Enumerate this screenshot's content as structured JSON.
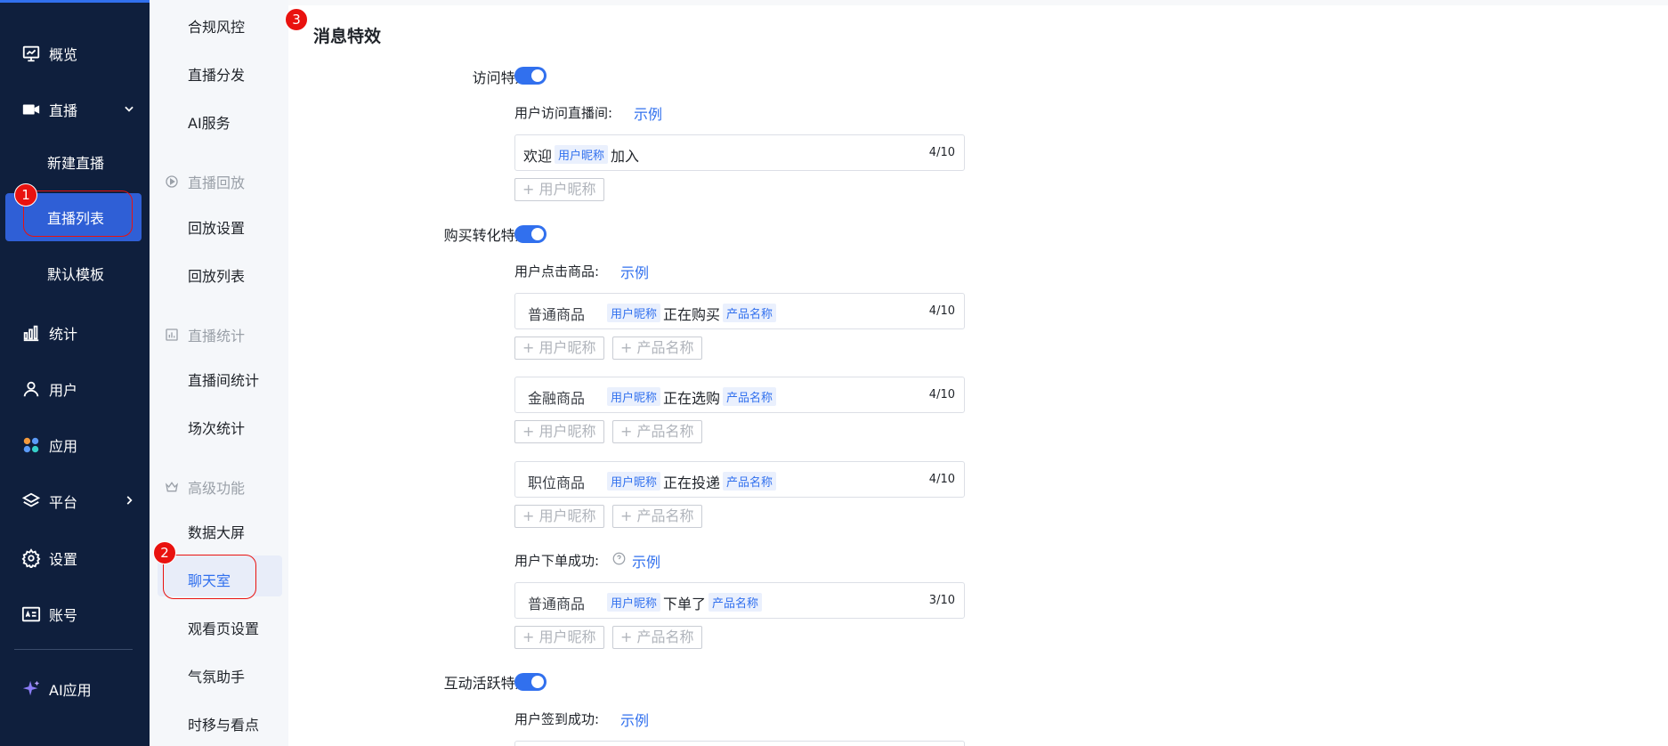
{
  "sidebar": {
    "items": [
      {
        "label": "概览",
        "icon": "monitor-icon"
      },
      {
        "label": "直播",
        "icon": "video-camera-icon"
      },
      {
        "label": "新建直播"
      },
      {
        "label": "直播列表"
      },
      {
        "label": "默认模板"
      },
      {
        "label": "统计",
        "icon": "bar-chart-icon"
      },
      {
        "label": "用户",
        "icon": "user-icon"
      },
      {
        "label": "应用",
        "icon": "apps-icon"
      },
      {
        "label": "平台",
        "icon": "layers-icon"
      },
      {
        "label": "设置",
        "icon": "gear-icon"
      },
      {
        "label": "账号",
        "icon": "id-card-icon"
      },
      {
        "label": "AI应用",
        "icon": "sparkle-icon"
      }
    ]
  },
  "submenu": {
    "items": [
      "合规风控",
      "直播分发",
      "AI服务",
      "回放设置",
      "回放列表",
      "直播间统计",
      "场次统计",
      "数据大屏",
      "聊天室",
      "观看页设置",
      "气氛助手",
      "时移与看点"
    ],
    "groups": [
      "直播回放",
      "直播统计",
      "高级功能"
    ]
  },
  "badges": [
    "1",
    "2",
    "3"
  ],
  "main": {
    "title": "消息特效",
    "visit": {
      "label": "访问特效:",
      "sub_label": "用户访问直播间:",
      "example": "示例",
      "tpl_pre": "欢迎",
      "tag_user": "用户昵称",
      "tpl_post": "加入",
      "count": "4/10",
      "add_user": "+ 用户昵称"
    },
    "buy": {
      "label": "购买转化特效:",
      "sub_label": "用户点击商品:",
      "example": "示例",
      "rows": [
        {
          "cat": "普通商品",
          "tag_user": "用户昵称",
          "verb": "正在购买",
          "tag_product": "产品名称",
          "count": "4/10"
        },
        {
          "cat": "金融商品",
          "tag_user": "用户昵称",
          "verb": "正在选购",
          "tag_product": "产品名称",
          "count": "4/10"
        },
        {
          "cat": "职位商品",
          "tag_user": "用户昵称",
          "verb": "正在投递",
          "tag_product": "产品名称",
          "count": "4/10"
        }
      ],
      "order_label": "用户下单成功:",
      "order_example": "示例",
      "order_row": {
        "cat": "普通商品",
        "tag_user": "用户昵称",
        "verb": "下单了",
        "tag_product": "产品名称",
        "count": "3/10"
      },
      "add_user": "+ 用户昵称",
      "add_product": "+ 产品名称"
    },
    "interact": {
      "label": "互动活跃特效:",
      "sub_label": "用户签到成功:",
      "example": "示例"
    }
  },
  "colors": {
    "accent": "#3170ee",
    "sidebar_bg": "#0f1f3d",
    "badge_red": "#e9120f"
  }
}
